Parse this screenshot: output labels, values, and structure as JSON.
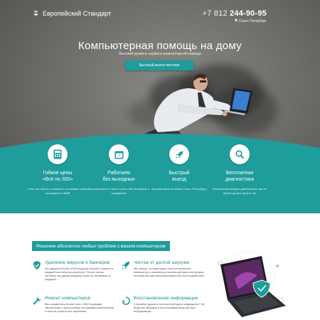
{
  "header": {
    "logo_text": "Европейский Стандарт",
    "phone_code": "+7 812 ",
    "phone_number": "244-90-95",
    "city": "Санкт-Петербург"
  },
  "hero": {
    "headline": "Компьютерная помощь на дому",
    "subheadline": "Высокий уровень сервиса компьютерной помощи",
    "cta_label": "Быстрый вызов мастера"
  },
  "features": [
    {
      "icon": "calculator-icon",
      "title_line1": "Гибкие цены",
      "title_line2": "«Всё по 300»",
      "desc": "У нас все просто: стоимость установки любых программ по 300₽"
    },
    {
      "icon": "calendar-icon",
      "title_line1": "Работаем",
      "title_line2": "без выходных",
      "desc": "Мы работаем 24 часа в сутки, без выходных и праздников"
    },
    {
      "icon": "rocket-icon",
      "title_line1": "Быстрый",
      "title_line2": "выезд",
      "desc": "Мы работаем по всему Санкт-Петербургу"
    },
    {
      "icon": "magnifier-icon",
      "title_line1": "Бесплатная",
      "title_line2": "диагностика",
      "desc": "Бесплатный выезд и диагностика, мы не берем деньги просто так"
    }
  ],
  "services": {
    "banner": "Решение абсолютно любых проблем с вашим компьютером",
    "items": [
      {
        "icon": "shield-icon",
        "title": "Удаление вирусов и баннеров",
        "desc": "Мы удалили более 4300 вирусов разной сложности, каждый раз получая результат. После чистки системы мы дарим каждому клиенту антивирус в подарок!"
      },
      {
        "icon": "rocket-icon",
        "title": "Чистка от долгой загрузки",
        "desc": "Мы знаем, что вам нужно быстро включить компьютер и заниматься своими делами или играми, поэтому мы сделаем максимальное быстродействие."
      },
      {
        "icon": "wrench-icon",
        "title": "Ремонт компьютеров",
        "desc": "Мы справились более чем с 3000 заказами связанными с различными поломками компьютеров и смогли решить все проблемы"
      },
      {
        "icon": "recycle-icon",
        "title": "Восстановление информации",
        "desc": "Случайно удалили или жесткий диск повредился? Не беда мы приедем и восстановим вашу ценную информацию"
      }
    ]
  },
  "colors": {
    "accent": "#1f9c9c",
    "hero_bg": "#6f6f6b"
  }
}
